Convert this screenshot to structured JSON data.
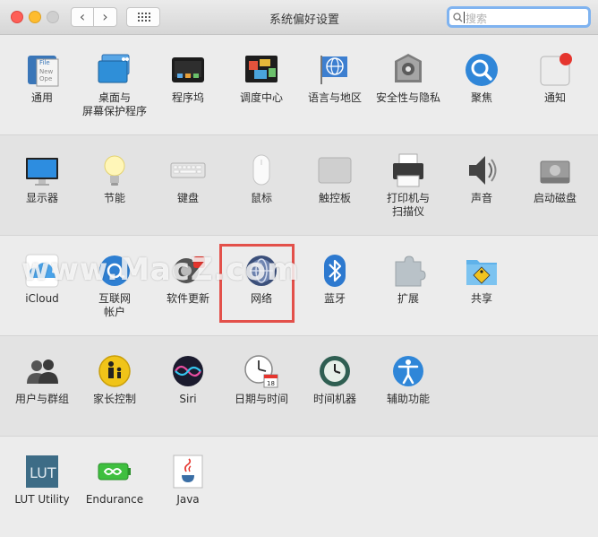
{
  "window": {
    "title": "系统偏好设置"
  },
  "toolbar": {
    "back_label": "‹",
    "forward_label": "›"
  },
  "search": {
    "placeholder": "搜索"
  },
  "rows": [
    {
      "items": [
        {
          "label": "通用",
          "icon": "general-icon"
        },
        {
          "label": "桌面与\n屏幕保护程序",
          "icon": "desktop-icon"
        },
        {
          "label": "程序坞",
          "icon": "dock-icon"
        },
        {
          "label": "调度中心",
          "icon": "mission-control-icon"
        },
        {
          "label": "语言与地区",
          "icon": "language-icon"
        },
        {
          "label": "安全性与隐私",
          "icon": "security-icon"
        },
        {
          "label": "聚焦",
          "icon": "spotlight-icon"
        },
        {
          "label": "通知",
          "icon": "notifications-icon"
        }
      ]
    },
    {
      "items": [
        {
          "label": "显示器",
          "icon": "display-icon"
        },
        {
          "label": "节能",
          "icon": "energy-icon"
        },
        {
          "label": "键盘",
          "icon": "keyboard-icon"
        },
        {
          "label": "鼠标",
          "icon": "mouse-icon"
        },
        {
          "label": "触控板",
          "icon": "trackpad-icon"
        },
        {
          "label": "打印机与\n扫描仪",
          "icon": "printer-icon"
        },
        {
          "label": "声音",
          "icon": "sound-icon"
        },
        {
          "label": "启动磁盘",
          "icon": "startup-disk-icon"
        }
      ]
    },
    {
      "items": [
        {
          "label": "iCloud",
          "icon": "icloud-icon"
        },
        {
          "label": "互联网\n帐户",
          "icon": "internet-accounts-icon"
        },
        {
          "label": "软件更新",
          "icon": "software-update-icon"
        },
        {
          "label": "网络",
          "icon": "network-icon"
        },
        {
          "label": "蓝牙",
          "icon": "bluetooth-icon"
        },
        {
          "label": "扩展",
          "icon": "extensions-icon"
        },
        {
          "label": "共享",
          "icon": "sharing-icon"
        }
      ]
    },
    {
      "items": [
        {
          "label": "用户与群组",
          "icon": "users-icon"
        },
        {
          "label": "家长控制",
          "icon": "parental-icon"
        },
        {
          "label": "Siri",
          "icon": "siri-icon"
        },
        {
          "label": "日期与时间",
          "icon": "datetime-icon"
        },
        {
          "label": "时间机器",
          "icon": "time-machine-icon"
        },
        {
          "label": "辅助功能",
          "icon": "accessibility-icon"
        }
      ]
    },
    {
      "items": [
        {
          "label": "LUT Utility",
          "icon": "lut-icon"
        },
        {
          "label": "Endurance",
          "icon": "endurance-icon"
        },
        {
          "label": "Java",
          "icon": "java-icon"
        }
      ]
    }
  ],
  "watermark": {
    "text": "www.MacZ.com"
  },
  "icon_text": {
    "file": "File",
    "new": "New",
    "ope": "Ope",
    "lut": "LUT",
    "cal": "18"
  }
}
